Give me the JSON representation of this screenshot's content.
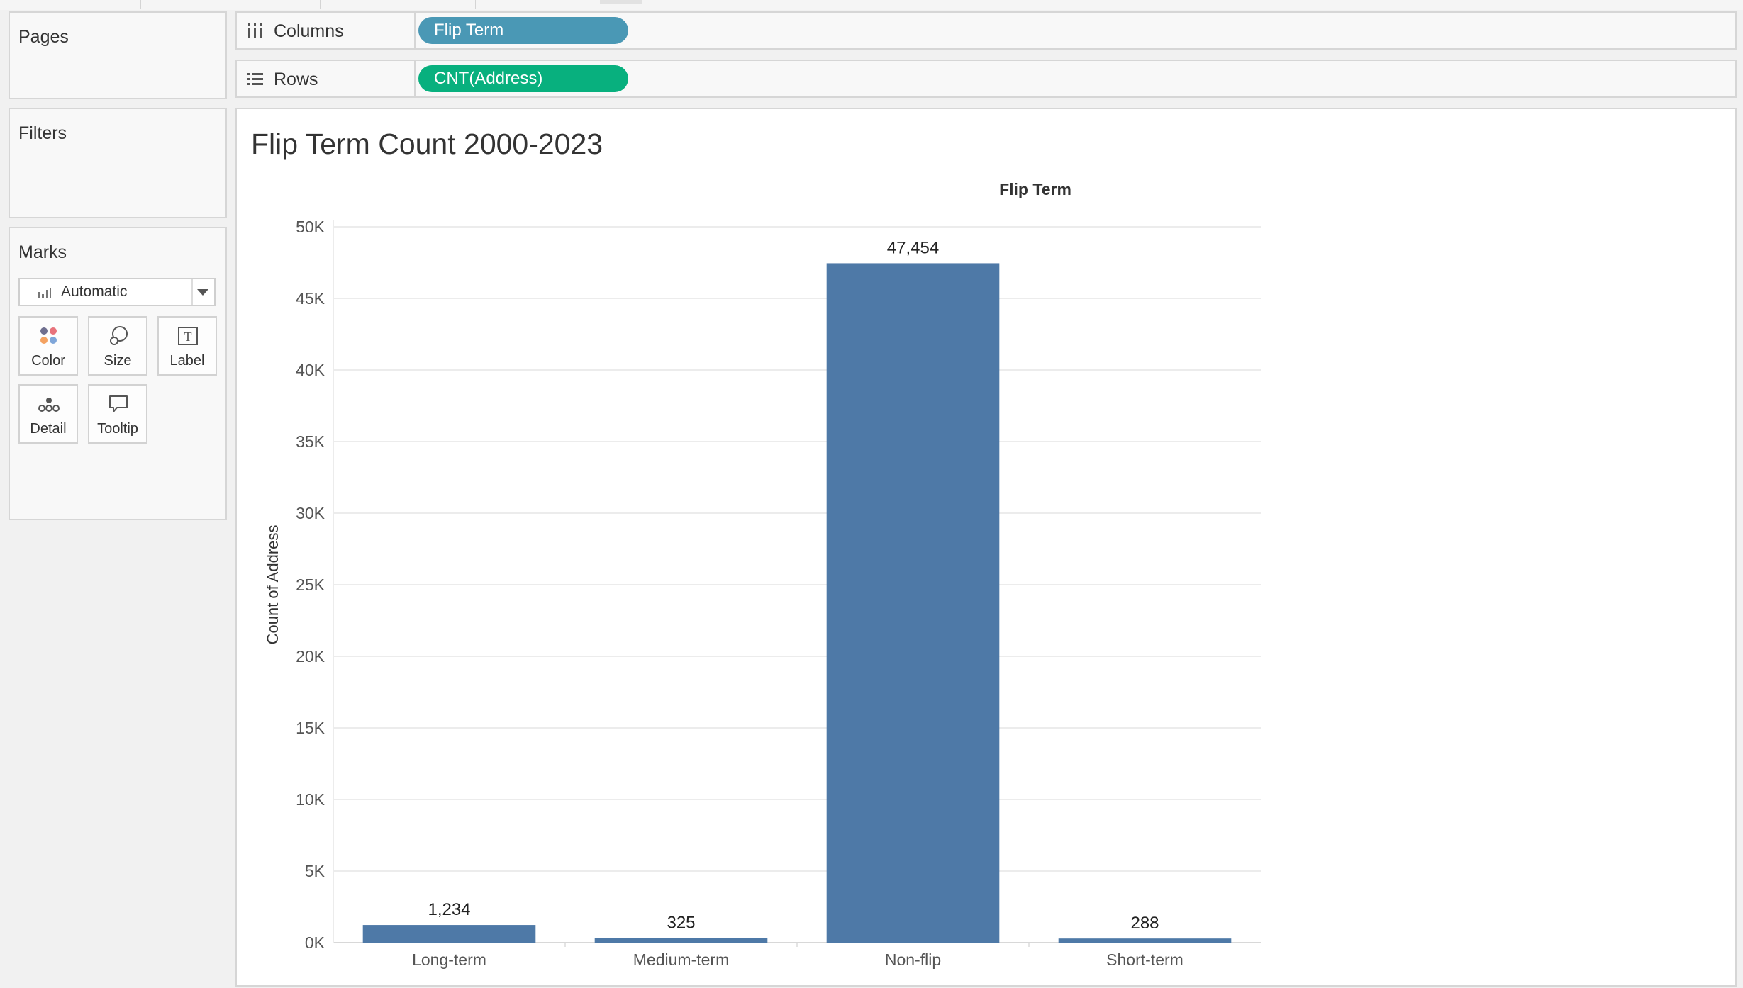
{
  "shelves": {
    "pages": {
      "title": "Pages"
    },
    "filters": {
      "title": "Filters"
    },
    "columns": {
      "label": "Columns",
      "pill": "Flip Term",
      "pill_color": "#4a98b5"
    },
    "rows": {
      "label": "Rows",
      "pill": "CNT(Address)",
      "pill_color": "#08b07e"
    }
  },
  "marks": {
    "title": "Marks",
    "type": "Automatic",
    "buttons": [
      {
        "label": "Color",
        "icon": "color-icon"
      },
      {
        "label": "Size",
        "icon": "size-icon"
      },
      {
        "label": "Label",
        "icon": "label-icon"
      },
      {
        "label": "Detail",
        "icon": "detail-icon"
      },
      {
        "label": "Tooltip",
        "icon": "tooltip-icon"
      }
    ]
  },
  "viz": {
    "title": "Flip Term Count 2000-2023",
    "column_header": "Flip Term"
  },
  "chart_data": {
    "type": "bar",
    "categories": [
      "Long-term",
      "Medium-term",
      "Non-flip",
      "Short-term"
    ],
    "values": [
      1234,
      325,
      47454,
      288
    ],
    "value_labels": [
      "1,234",
      "325",
      "47,454",
      "288"
    ],
    "yticks": [
      0,
      5000,
      10000,
      15000,
      20000,
      25000,
      30000,
      35000,
      40000,
      45000,
      50000
    ],
    "ytick_labels": [
      "0K",
      "5K",
      "10K",
      "15K",
      "20K",
      "25K",
      "30K",
      "35K",
      "40K",
      "45K",
      "50K"
    ],
    "ylabel": "Count of Address",
    "xlabel": "",
    "title": "Flip Term",
    "ylim": [
      0,
      50000
    ],
    "bar_color": "#4e79a7",
    "grid": true
  }
}
